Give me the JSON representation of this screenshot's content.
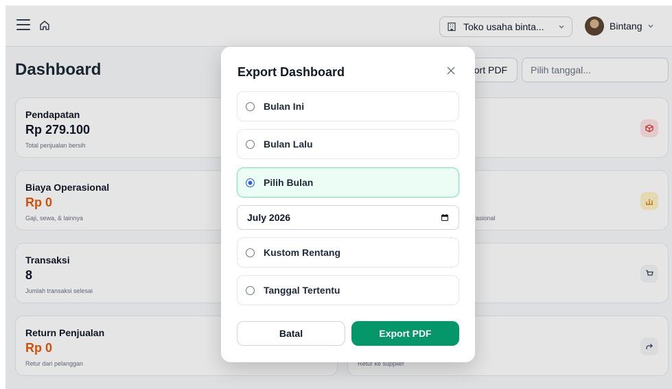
{
  "topbar": {
    "store_name": "Toko usaha binta...",
    "user_name": "Bintang"
  },
  "dashboard": {
    "title": "Dashboard",
    "export_button": "Export PDF",
    "export_button_visible": "port PDF",
    "date_placeholder": "Pilih tanggal...",
    "cards": [
      {
        "title": "Pendapatan",
        "value": "Rp 279.100",
        "subtitle": "Total penjualan bersih"
      },
      {
        "title": "Biaya Operasional",
        "value": "Rp 0",
        "subtitle": "Gaji, sewa, & lainnya"
      },
      {
        "title": "Transaksi",
        "value": "8",
        "subtitle": "Jumlah transaksi selesai"
      },
      {
        "title": "Return Penjualan",
        "value": "Rp 0",
        "subtitle": "Retur dari pelanggan"
      }
    ],
    "right_card_fragments": [
      "erasional",
      "Retur ke supplier"
    ]
  },
  "modal": {
    "title": "Export Dashboard",
    "options": [
      {
        "label": "Bulan Ini",
        "selected": false
      },
      {
        "label": "Bulan Lalu",
        "selected": false
      },
      {
        "label": "Pilih Bulan",
        "selected": true
      },
      {
        "label": "Kustom Rentang",
        "selected": false
      },
      {
        "label": "Tanggal Tertentu",
        "selected": false
      }
    ],
    "month_value": "July 2026",
    "cancel_label": "Batal",
    "export_label": "Export PDF"
  },
  "colors": {
    "primary": "#059669",
    "selected_bg": "#ecfdf5",
    "radio_checked": "#2563eb",
    "accent_orange": "#ea580c"
  }
}
